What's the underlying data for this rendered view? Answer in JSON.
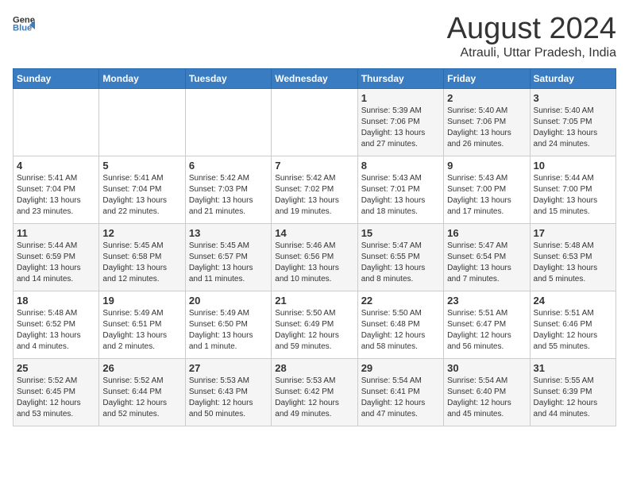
{
  "logo": {
    "general": "General",
    "blue": "Blue"
  },
  "title": {
    "month_year": "August 2024",
    "location": "Atrauli, Uttar Pradesh, India"
  },
  "days_of_week": [
    "Sunday",
    "Monday",
    "Tuesday",
    "Wednesday",
    "Thursday",
    "Friday",
    "Saturday"
  ],
  "weeks": [
    [
      {
        "day": "",
        "info": ""
      },
      {
        "day": "",
        "info": ""
      },
      {
        "day": "",
        "info": ""
      },
      {
        "day": "",
        "info": ""
      },
      {
        "day": "1",
        "info": "Sunrise: 5:39 AM\nSunset: 7:06 PM\nDaylight: 13 hours\nand 27 minutes."
      },
      {
        "day": "2",
        "info": "Sunrise: 5:40 AM\nSunset: 7:06 PM\nDaylight: 13 hours\nand 26 minutes."
      },
      {
        "day": "3",
        "info": "Sunrise: 5:40 AM\nSunset: 7:05 PM\nDaylight: 13 hours\nand 24 minutes."
      }
    ],
    [
      {
        "day": "4",
        "info": "Sunrise: 5:41 AM\nSunset: 7:04 PM\nDaylight: 13 hours\nand 23 minutes."
      },
      {
        "day": "5",
        "info": "Sunrise: 5:41 AM\nSunset: 7:04 PM\nDaylight: 13 hours\nand 22 minutes."
      },
      {
        "day": "6",
        "info": "Sunrise: 5:42 AM\nSunset: 7:03 PM\nDaylight: 13 hours\nand 21 minutes."
      },
      {
        "day": "7",
        "info": "Sunrise: 5:42 AM\nSunset: 7:02 PM\nDaylight: 13 hours\nand 19 minutes."
      },
      {
        "day": "8",
        "info": "Sunrise: 5:43 AM\nSunset: 7:01 PM\nDaylight: 13 hours\nand 18 minutes."
      },
      {
        "day": "9",
        "info": "Sunrise: 5:43 AM\nSunset: 7:00 PM\nDaylight: 13 hours\nand 17 minutes."
      },
      {
        "day": "10",
        "info": "Sunrise: 5:44 AM\nSunset: 7:00 PM\nDaylight: 13 hours\nand 15 minutes."
      }
    ],
    [
      {
        "day": "11",
        "info": "Sunrise: 5:44 AM\nSunset: 6:59 PM\nDaylight: 13 hours\nand 14 minutes."
      },
      {
        "day": "12",
        "info": "Sunrise: 5:45 AM\nSunset: 6:58 PM\nDaylight: 13 hours\nand 12 minutes."
      },
      {
        "day": "13",
        "info": "Sunrise: 5:45 AM\nSunset: 6:57 PM\nDaylight: 13 hours\nand 11 minutes."
      },
      {
        "day": "14",
        "info": "Sunrise: 5:46 AM\nSunset: 6:56 PM\nDaylight: 13 hours\nand 10 minutes."
      },
      {
        "day": "15",
        "info": "Sunrise: 5:47 AM\nSunset: 6:55 PM\nDaylight: 13 hours\nand 8 minutes."
      },
      {
        "day": "16",
        "info": "Sunrise: 5:47 AM\nSunset: 6:54 PM\nDaylight: 13 hours\nand 7 minutes."
      },
      {
        "day": "17",
        "info": "Sunrise: 5:48 AM\nSunset: 6:53 PM\nDaylight: 13 hours\nand 5 minutes."
      }
    ],
    [
      {
        "day": "18",
        "info": "Sunrise: 5:48 AM\nSunset: 6:52 PM\nDaylight: 13 hours\nand 4 minutes."
      },
      {
        "day": "19",
        "info": "Sunrise: 5:49 AM\nSunset: 6:51 PM\nDaylight: 13 hours\nand 2 minutes."
      },
      {
        "day": "20",
        "info": "Sunrise: 5:49 AM\nSunset: 6:50 PM\nDaylight: 13 hours\nand 1 minute."
      },
      {
        "day": "21",
        "info": "Sunrise: 5:50 AM\nSunset: 6:49 PM\nDaylight: 12 hours\nand 59 minutes."
      },
      {
        "day": "22",
        "info": "Sunrise: 5:50 AM\nSunset: 6:48 PM\nDaylight: 12 hours\nand 58 minutes."
      },
      {
        "day": "23",
        "info": "Sunrise: 5:51 AM\nSunset: 6:47 PM\nDaylight: 12 hours\nand 56 minutes."
      },
      {
        "day": "24",
        "info": "Sunrise: 5:51 AM\nSunset: 6:46 PM\nDaylight: 12 hours\nand 55 minutes."
      }
    ],
    [
      {
        "day": "25",
        "info": "Sunrise: 5:52 AM\nSunset: 6:45 PM\nDaylight: 12 hours\nand 53 minutes."
      },
      {
        "day": "26",
        "info": "Sunrise: 5:52 AM\nSunset: 6:44 PM\nDaylight: 12 hours\nand 52 minutes."
      },
      {
        "day": "27",
        "info": "Sunrise: 5:53 AM\nSunset: 6:43 PM\nDaylight: 12 hours\nand 50 minutes."
      },
      {
        "day": "28",
        "info": "Sunrise: 5:53 AM\nSunset: 6:42 PM\nDaylight: 12 hours\nand 49 minutes."
      },
      {
        "day": "29",
        "info": "Sunrise: 5:54 AM\nSunset: 6:41 PM\nDaylight: 12 hours\nand 47 minutes."
      },
      {
        "day": "30",
        "info": "Sunrise: 5:54 AM\nSunset: 6:40 PM\nDaylight: 12 hours\nand 45 minutes."
      },
      {
        "day": "31",
        "info": "Sunrise: 5:55 AM\nSunset: 6:39 PM\nDaylight: 12 hours\nand 44 minutes."
      }
    ]
  ]
}
